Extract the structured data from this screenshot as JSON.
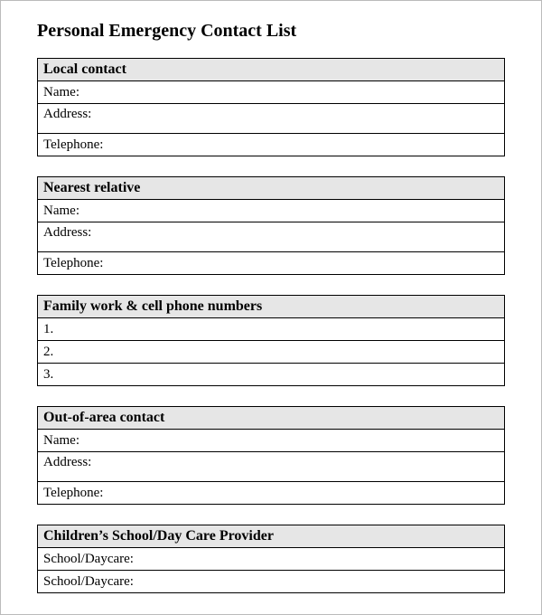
{
  "title": "Personal Emergency Contact List",
  "sections": {
    "local_contact": {
      "header": "Local contact",
      "name_label": "Name:",
      "address_label": "Address:",
      "telephone_label": "Telephone:"
    },
    "nearest_relative": {
      "header": "Nearest relative",
      "name_label": "Name:",
      "address_label": "Address:",
      "telephone_label": "Telephone:"
    },
    "family_phones": {
      "header": "Family work & cell phone numbers",
      "row1": "1.",
      "row2": "2.",
      "row3": "3."
    },
    "out_of_area": {
      "header": "Out-of-area contact",
      "name_label": "Name:",
      "address_label": "Address:",
      "telephone_label": "Telephone:"
    },
    "school_daycare": {
      "header": "Children’s School/Day Care Provider",
      "row1": "School/Daycare:",
      "row2": "School/Daycare:"
    }
  }
}
